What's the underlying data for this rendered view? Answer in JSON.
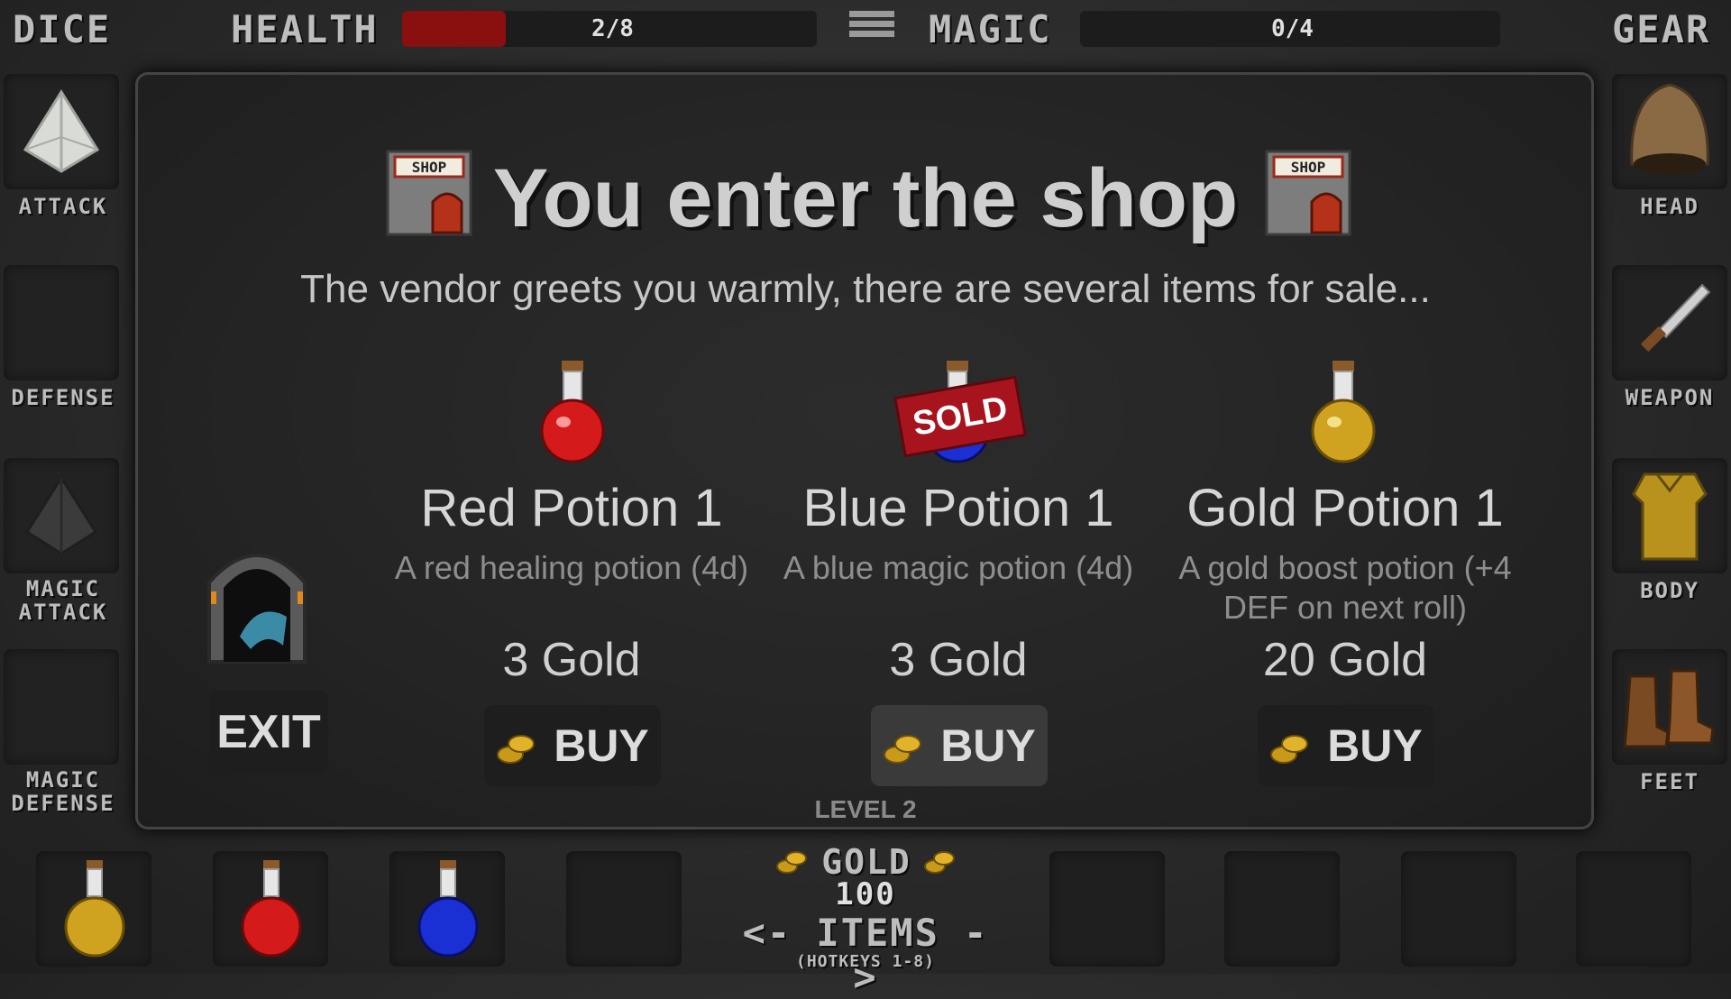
{
  "topbar": {
    "dice_label": "DICE",
    "health_label": "HEALTH",
    "health_value": "2/8",
    "health_fraction": 0.25,
    "magic_label": "MAGIC",
    "magic_value": "0/4",
    "magic_fraction": 0,
    "gear_label": "GEAR"
  },
  "dice_slots": [
    {
      "label": "ATTACK",
      "icon": "d4-die-white-icon"
    },
    {
      "label": "DEFENSE",
      "icon": "empty"
    },
    {
      "label": "MAGIC ATTACK",
      "icon": "d4-die-black-icon"
    },
    {
      "label": "MAGIC DEFENSE",
      "icon": "empty"
    }
  ],
  "gear_slots": [
    {
      "label": "HEAD",
      "icon": "leather-hood-icon"
    },
    {
      "label": "WEAPON",
      "icon": "dagger-icon"
    },
    {
      "label": "BODY",
      "icon": "gold-armor-icon"
    },
    {
      "label": "FEET",
      "icon": "leather-boots-icon"
    }
  ],
  "shop": {
    "title": "You enter the shop",
    "subtitle": "The vendor greets you warmly, there are several items for sale...",
    "shop_sign_text": "SHOP",
    "exit_label": "EXIT",
    "items": [
      {
        "name": "Red Potion 1",
        "desc": "A red healing potion (4d)",
        "price": "3 Gold",
        "buy_label": "BUY",
        "color": "#d41a1a",
        "sold": false
      },
      {
        "name": "Blue Potion 1",
        "desc": "A blue magic potion (4d)",
        "price": "3 Gold",
        "buy_label": "BUY",
        "color": "#1a2fd4",
        "sold": true,
        "sold_label": "SOLD"
      },
      {
        "name": "Gold Potion 1",
        "desc": "A gold boost potion (+4 DEF on next roll)",
        "price": "20 Gold",
        "buy_label": "BUY",
        "color": "#cfa21f",
        "sold": false
      }
    ]
  },
  "footer": {
    "level": "LEVEL 2",
    "gold_label": "GOLD",
    "gold_value": "100",
    "items_label": "<- ITEMS ->",
    "hotkeys": "(HOTKEYS 1-8)"
  },
  "inventory": [
    {
      "slot": 1,
      "item": "gold-potion",
      "color": "#cfa21f"
    },
    {
      "slot": 2,
      "item": "red-potion",
      "color": "#d41a1a"
    },
    {
      "slot": 3,
      "item": "blue-potion",
      "color": "#1a2fd4"
    },
    {
      "slot": 4,
      "item": "empty"
    },
    {
      "slot": 5,
      "item": "empty"
    },
    {
      "slot": 6,
      "item": "empty"
    },
    {
      "slot": 7,
      "item": "empty"
    },
    {
      "slot": 8,
      "item": "empty"
    }
  ]
}
